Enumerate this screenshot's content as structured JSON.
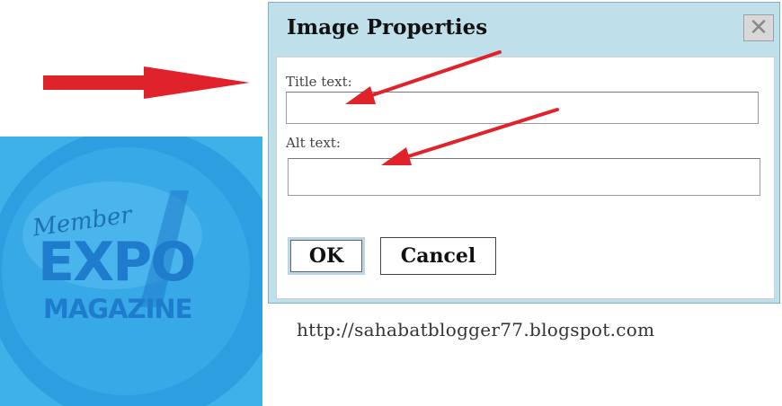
{
  "dialog": {
    "title": "Image Properties",
    "close_glyph": "✕",
    "title_label": "Title text:",
    "title_value": "",
    "alt_label": "Alt text:",
    "alt_value": "",
    "ok_label": "OK",
    "cancel_label": "Cancel"
  },
  "logo": {
    "member": "Member",
    "expo": "EXPO",
    "magazine": "MAGAZINE"
  },
  "footer": {
    "url": "http://sahabatblogger77.blogspot.com"
  },
  "colors": {
    "arrow": "#e0222a",
    "logo_background": "#3fb1e9",
    "dialog_header": "#bfe0ea"
  },
  "icons": {
    "close": "close-icon",
    "arrow": "red-arrow-icon"
  }
}
